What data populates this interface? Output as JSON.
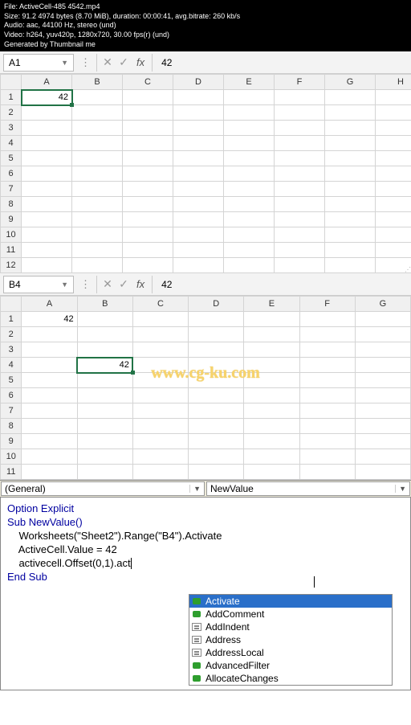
{
  "media_info": {
    "line1": "File: ActiveCell-485 4542.mp4",
    "line2": "Size: 91.2 4974 bytes (8.70 MiB), duration: 00:00:41, avg.bitrate: 260 kb/s",
    "line3": "Audio: aac, 44100 Hz, stereo (und)",
    "line4": "Video: h264, yuv420p, 1280x720, 30.00 fps(r) (und)",
    "line5": "Generated by Thumbnail me"
  },
  "sheet1": {
    "name_box": "A1",
    "formula_value": "42",
    "cols": [
      "A",
      "B",
      "C",
      "D",
      "E",
      "F",
      "G",
      "H"
    ],
    "rows": [
      "1",
      "2",
      "3",
      "4",
      "5",
      "6",
      "7",
      "8",
      "9",
      "10",
      "11",
      "12"
    ],
    "cell_a1": "42"
  },
  "sheet2": {
    "name_box": "B4",
    "formula_value": "42",
    "cols": [
      "A",
      "B",
      "C",
      "D",
      "E",
      "F",
      "G"
    ],
    "rows": [
      "1",
      "2",
      "3",
      "4",
      "5",
      "6",
      "7",
      "8",
      "9",
      "10",
      "11"
    ],
    "cell_a1": "42",
    "cell_b4": "42"
  },
  "watermark": "www.cg-ku.com",
  "vba": {
    "proc_left": "(General)",
    "proc_right": "NewValue",
    "code": {
      "l1": "Option Explicit",
      "l2": "",
      "l3": "Sub NewValue()",
      "l4": "",
      "l5": "    Worksheets(\"Sheet2\").Range(\"B4\").Activate",
      "l6": "    ActiveCell.Value = 42",
      "l7a": "    activecell.Offset(0,1).act",
      "l8": "",
      "l9": "End Sub"
    },
    "autocomplete": {
      "items": [
        {
          "label": "Activate",
          "kind": "method",
          "selected": true
        },
        {
          "label": "AddComment",
          "kind": "method",
          "selected": false
        },
        {
          "label": "AddIndent",
          "kind": "prop",
          "selected": false
        },
        {
          "label": "Address",
          "kind": "prop",
          "selected": false
        },
        {
          "label": "AddressLocal",
          "kind": "prop",
          "selected": false
        },
        {
          "label": "AdvancedFilter",
          "kind": "method",
          "selected": false
        },
        {
          "label": "AllocateChanges",
          "kind": "method",
          "selected": false
        }
      ]
    }
  }
}
